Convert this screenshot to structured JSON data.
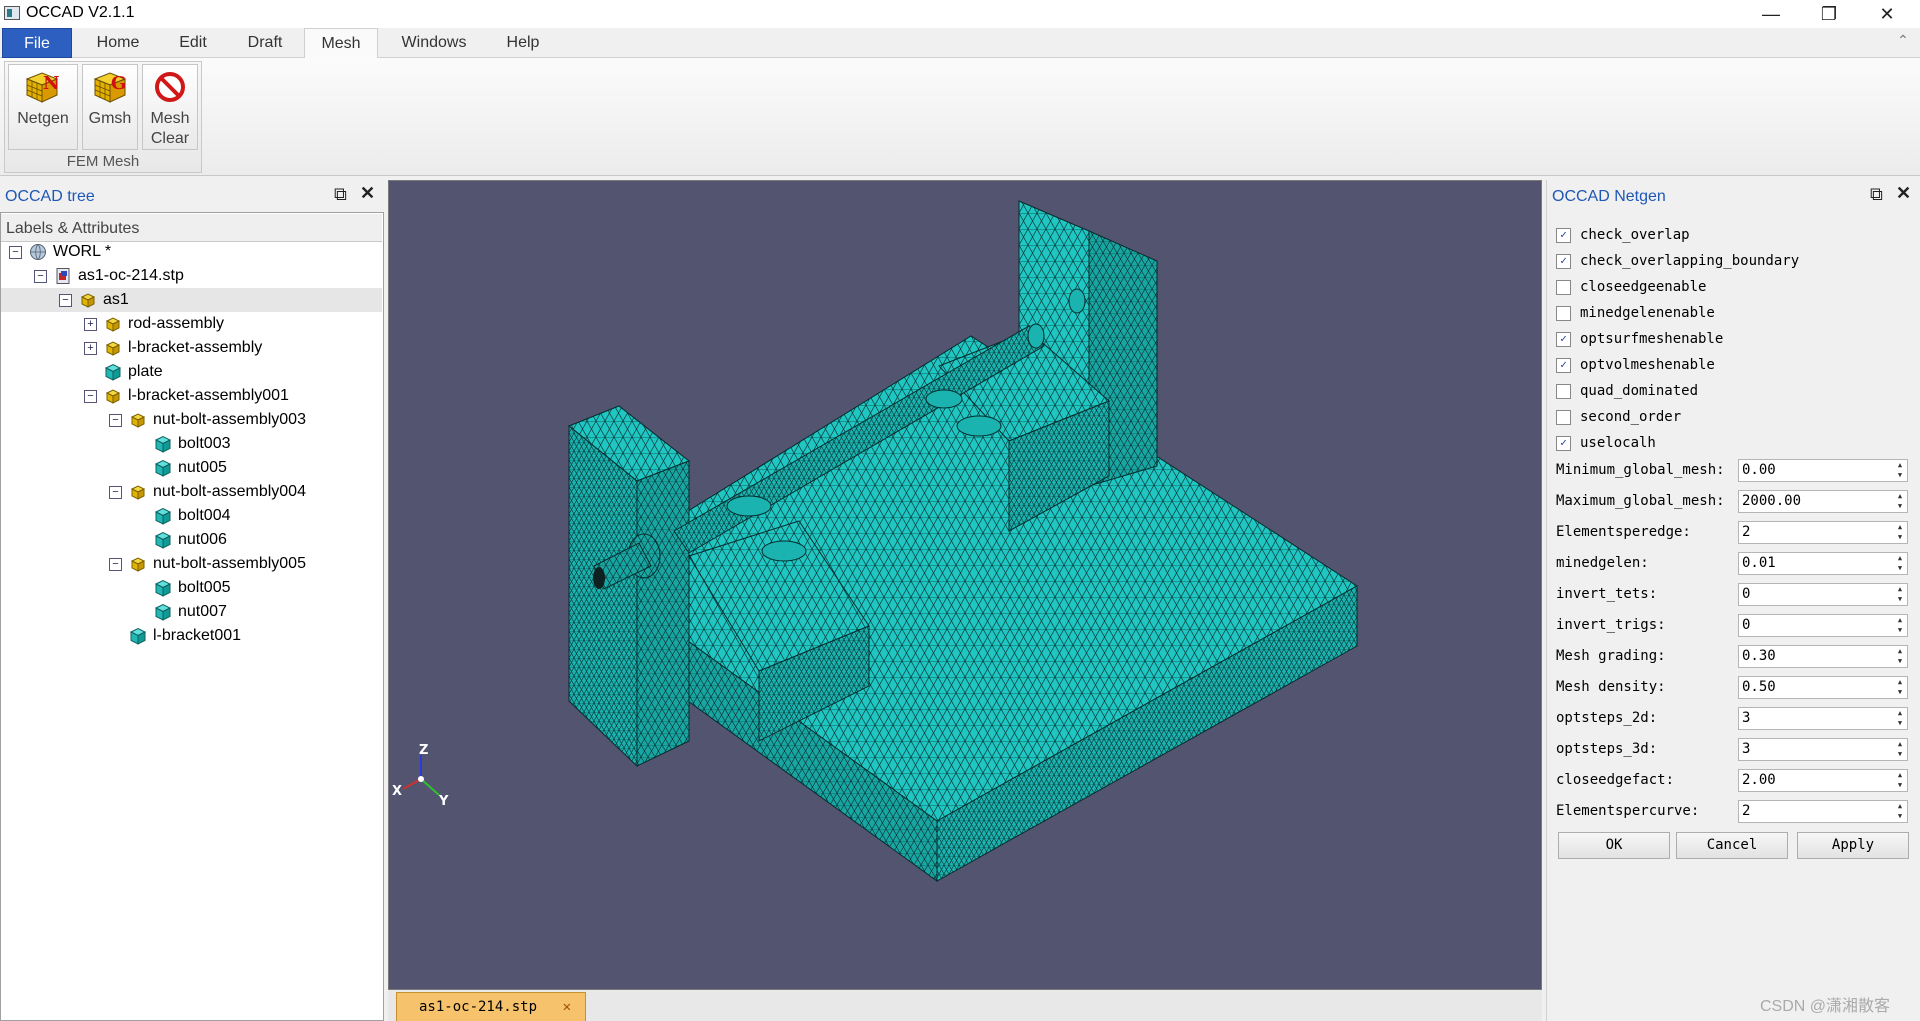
{
  "window": {
    "title": "OCCAD V2.1.1",
    "controls": {
      "minimize": "—",
      "restore": "❐",
      "close": "✕"
    }
  },
  "menu": {
    "tabs": [
      "File",
      "Home",
      "Edit",
      "Draft",
      "Mesh",
      "Windows",
      "Help"
    ],
    "active_tab": "Mesh"
  },
  "ribbon": {
    "group_label": "FEM Mesh",
    "buttons": [
      {
        "label": "Netgen",
        "icon": "netgen-cube-icon"
      },
      {
        "label": "Gmsh",
        "icon": "gmsh-cube-icon"
      },
      {
        "label": "Mesh\nClear",
        "icon": "no-entry-icon"
      }
    ]
  },
  "tree_panel": {
    "title": "OCCAD tree",
    "header": "Labels & Attributes",
    "items": [
      {
        "label": "WORL *",
        "depth": 0,
        "expander": "minus",
        "icon": "globe-icon"
      },
      {
        "label": "as1-oc-214.stp",
        "depth": 1,
        "expander": "minus",
        "icon": "document-icon"
      },
      {
        "label": "as1",
        "depth": 2,
        "expander": "minus",
        "icon": "assembly-icon",
        "selected": true
      },
      {
        "label": "rod-assembly",
        "depth": 3,
        "expander": "plus",
        "icon": "assembly-icon"
      },
      {
        "label": "l-bracket-assembly",
        "depth": 3,
        "expander": "plus",
        "icon": "assembly-icon"
      },
      {
        "label": "plate",
        "depth": 3,
        "expander": "none",
        "icon": "part-icon"
      },
      {
        "label": "l-bracket-assembly001",
        "depth": 3,
        "expander": "minus",
        "icon": "assembly-icon"
      },
      {
        "label": "nut-bolt-assembly003",
        "depth": 4,
        "expander": "minus",
        "icon": "assembly-icon"
      },
      {
        "label": "bolt003",
        "depth": 5,
        "expander": "none",
        "icon": "part-icon"
      },
      {
        "label": "nut005",
        "depth": 5,
        "expander": "none",
        "icon": "part-icon"
      },
      {
        "label": "nut-bolt-assembly004",
        "depth": 4,
        "expander": "minus",
        "icon": "assembly-icon"
      },
      {
        "label": "bolt004",
        "depth": 5,
        "expander": "none",
        "icon": "part-icon"
      },
      {
        "label": "nut006",
        "depth": 5,
        "expander": "none",
        "icon": "part-icon"
      },
      {
        "label": "nut-bolt-assembly005",
        "depth": 4,
        "expander": "minus",
        "icon": "assembly-icon"
      },
      {
        "label": "bolt005",
        "depth": 5,
        "expander": "none",
        "icon": "part-icon"
      },
      {
        "label": "nut007",
        "depth": 5,
        "expander": "none",
        "icon": "part-icon"
      },
      {
        "label": "l-bracket001",
        "depth": 4,
        "expander": "none",
        "icon": "part-icon"
      }
    ]
  },
  "viewport": {
    "axes": {
      "z": "Z",
      "x": "X",
      "y": "Y"
    },
    "mesh_color": "#1fc4c0"
  },
  "doc_tab": {
    "label": "as1-oc-214.stp",
    "close": "✕"
  },
  "netgen_panel": {
    "title": "OCCAD Netgen",
    "options": [
      {
        "label": "check_overlap",
        "checked": true
      },
      {
        "label": "check_overlapping_boundary",
        "checked": true
      },
      {
        "label": "closeedgeenable",
        "checked": false
      },
      {
        "label": "minedgelenenable",
        "checked": false
      },
      {
        "label": "optsurfmeshenable",
        "checked": true
      },
      {
        "label": "optvolmeshenable",
        "checked": true
      },
      {
        "label": "quad_dominated",
        "checked": false
      },
      {
        "label": "second_order",
        "checked": false
      },
      {
        "label": "uselocalh",
        "checked": true
      }
    ],
    "params": [
      {
        "label": "Minimum_global_mesh:",
        "value": "0.00"
      },
      {
        "label": "Maximum_global_mesh:",
        "value": "2000.00"
      },
      {
        "label": "Elementsperedge:",
        "value": "2"
      },
      {
        "label": "minedgelen:",
        "value": "0.01"
      },
      {
        "label": "invert_tets:",
        "value": "0"
      },
      {
        "label": "invert_trigs:",
        "value": "0"
      },
      {
        "label": "Mesh grading:",
        "value": "0.30"
      },
      {
        "label": "Mesh density:",
        "value": "0.50"
      },
      {
        "label": "optsteps_2d:",
        "value": "3"
      },
      {
        "label": "optsteps_3d:",
        "value": "3"
      },
      {
        "label": "closeedgefact:",
        "value": "2.00"
      },
      {
        "label": "Elementspercurve:",
        "value": "2"
      }
    ],
    "buttons": {
      "ok": "OK",
      "cancel": "Cancel",
      "apply": "Apply"
    }
  },
  "watermark": "CSDN @潇湘散客"
}
